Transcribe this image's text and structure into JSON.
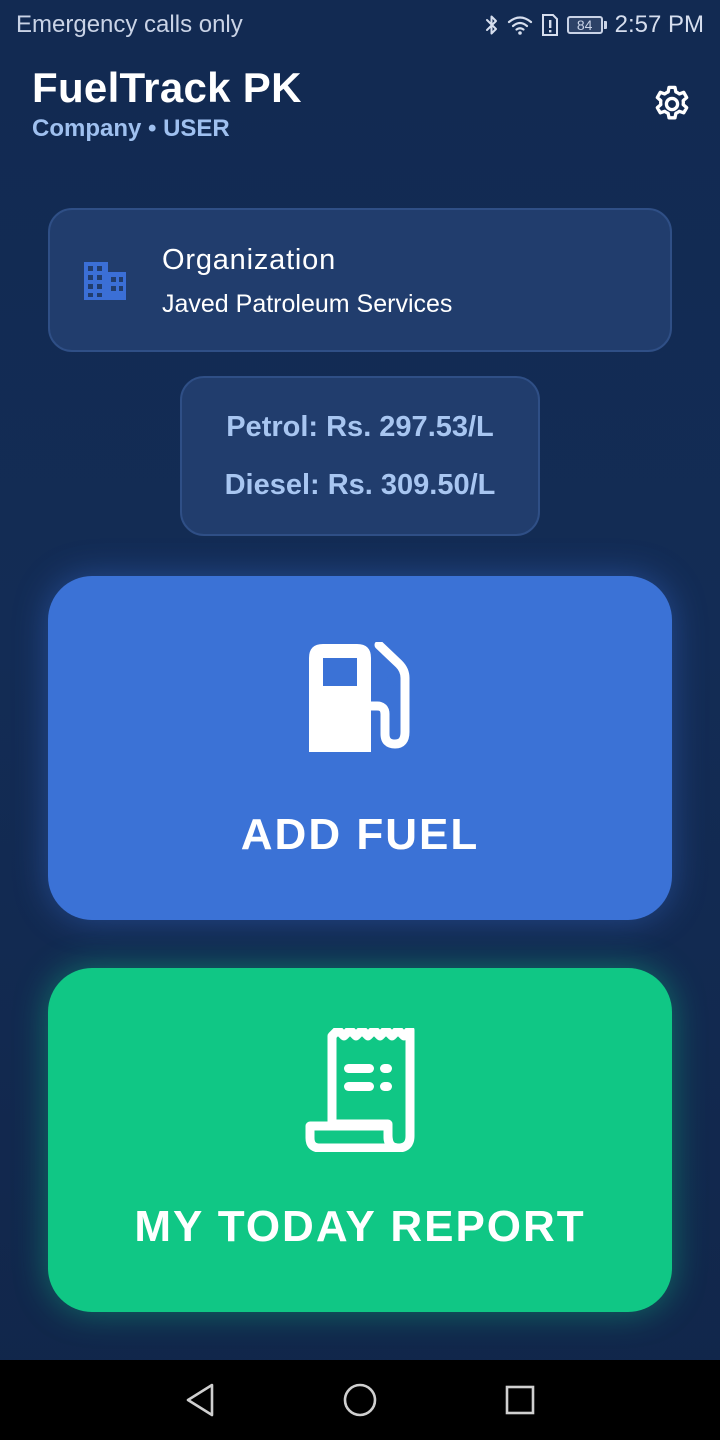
{
  "status_bar": {
    "carrier_text": "Emergency calls only",
    "battery_level": "84",
    "time": "2:57 PM",
    "icons": [
      "bluetooth-icon",
      "wifi-icon",
      "alert-icon",
      "battery-icon"
    ]
  },
  "header": {
    "title": "FuelTrack PK",
    "subtitle": "Company • USER",
    "settings_icon": "gear-icon"
  },
  "organization": {
    "label": "Organization",
    "name": "Javed Patroleum Services",
    "icon": "building-icon"
  },
  "prices": {
    "petrol": "Petrol: Rs. 297.53/L",
    "diesel": "Diesel: Rs. 309.50/L"
  },
  "actions": {
    "add_fuel": {
      "label": "ADD FUEL",
      "icon": "fuel-pump-icon",
      "color": "#3b72d6"
    },
    "today_report": {
      "label": "MY TODAY REPORT",
      "icon": "receipt-icon",
      "color": "#10c785"
    }
  },
  "nav_bar": {
    "icons": [
      "back-icon",
      "home-icon",
      "recents-icon"
    ]
  },
  "colors": {
    "background": "#122a52",
    "card": "#213d6d",
    "subtitle": "#9fc0ef",
    "price_text": "#a8c6f1"
  }
}
